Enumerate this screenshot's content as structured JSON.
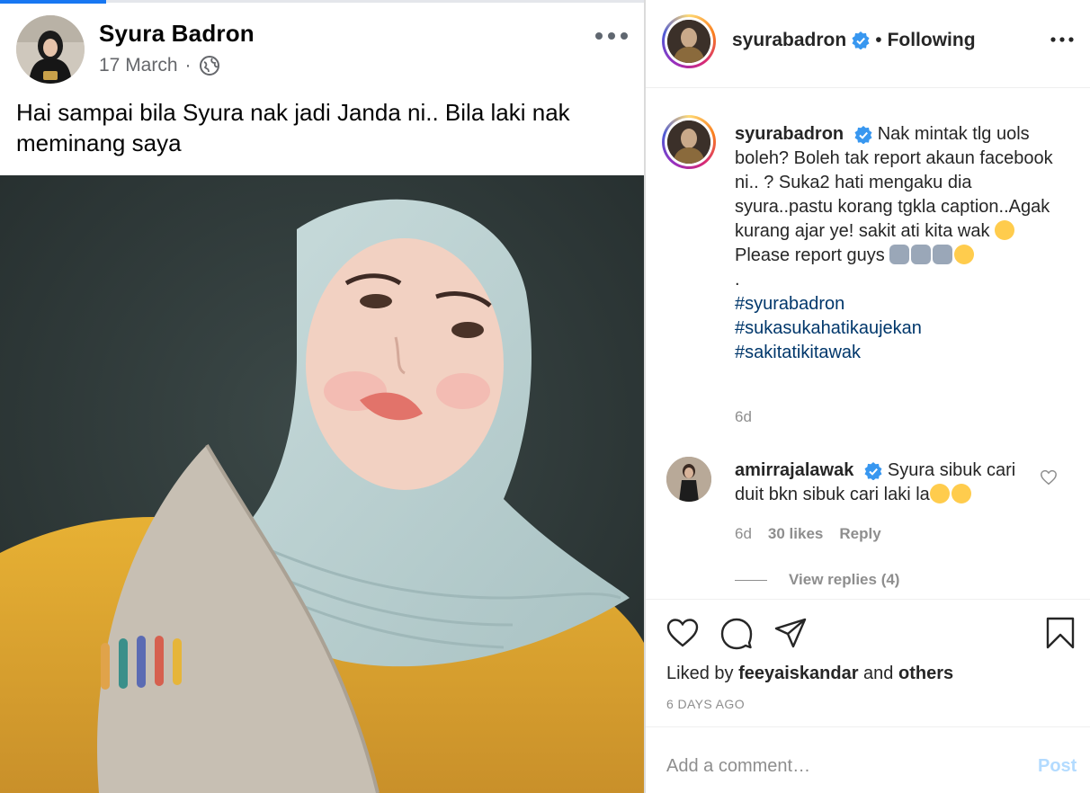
{
  "facebook": {
    "author": "Syura Badron",
    "date": "17 March",
    "separator": "·",
    "caption": "Hai sampai bila Syura nak jadi Janda ni.. Bila laki nak meminang saya"
  },
  "instagram": {
    "header": {
      "username": "syurabadron",
      "separator": "•",
      "follow_status": "Following"
    },
    "post": {
      "username": "syurabadron",
      "text_lines": [
        "Nak mintak tlg uols boleh? Boleh tak report akaun facebook ni.. ? Suka2 hati mengaku dia syura..pastu korang tgkla caption..Agak kurang ajar ye! sakit ati kita wak",
        "Please report guys",
        "."
      ],
      "hashtags": [
        "#syurabadron",
        "#sukasukahatikaujekan",
        "#sakitatikitawak"
      ],
      "timestamp": "6d"
    },
    "comment": {
      "username": "amirrajalawak",
      "text": "Syura sibuk cari duit bkn sibuk cari laki la",
      "time": "6d",
      "likes": "30 likes",
      "reply": "Reply",
      "view_replies": "View replies (4)"
    },
    "likes": {
      "prefix": "Liked by",
      "user": "feeyaiskandar",
      "conj": "and",
      "others": "others"
    },
    "post_age": "6 DAYS AGO",
    "add_comment_placeholder": "Add a comment…",
    "post_button": "Post",
    "colors": {
      "verified": "#3897f0",
      "hashtag": "#00376b",
      "muted": "#8e8e8e",
      "post_button_disabled": "#b3dbff",
      "facebook_blue": "#1877f2"
    }
  }
}
